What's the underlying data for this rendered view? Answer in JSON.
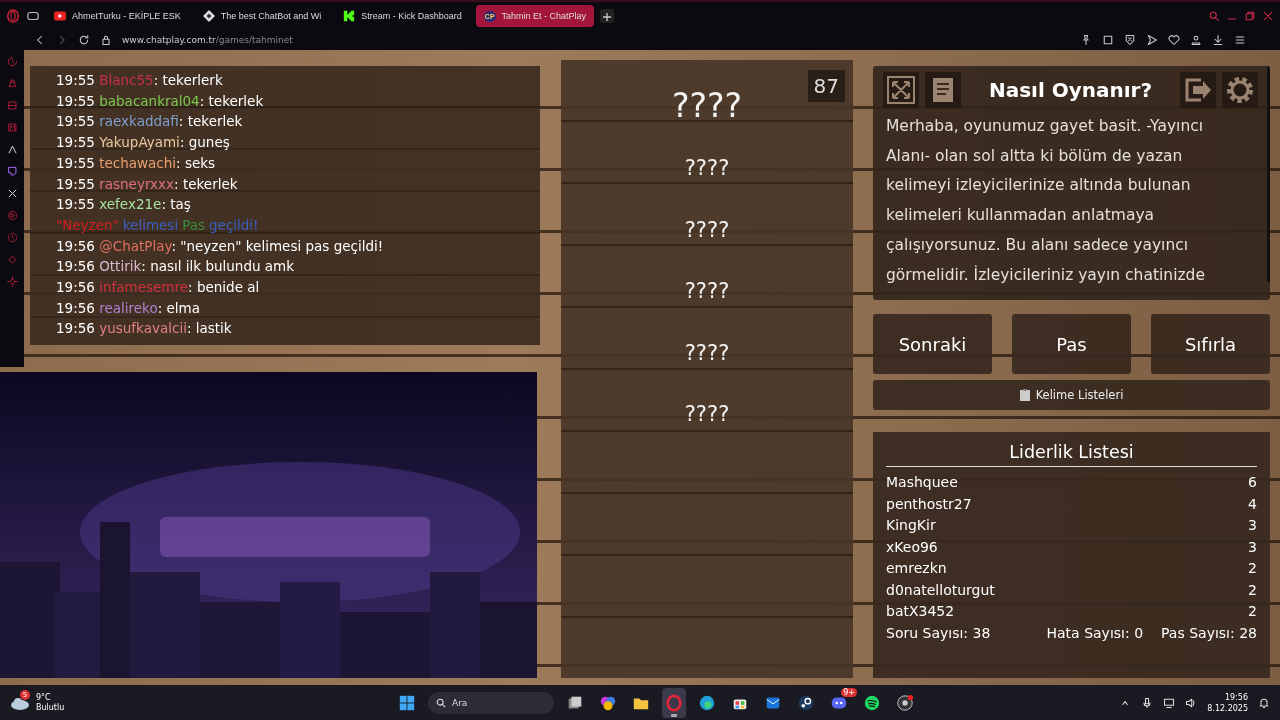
{
  "browser": {
    "tabs": [
      {
        "label": "AhmetTurku - EKİPLE ESK",
        "selected": false
      },
      {
        "label": "The best ChatBot and Wi",
        "selected": false
      },
      {
        "label": "Stream - Kick Dashboard",
        "selected": false
      },
      {
        "label": "Tahmin Et - ChatPlay",
        "badge": "CP",
        "selected": true
      }
    ],
    "address": {
      "domain": "www.chatplay.com.tr",
      "path": "/games/tahminet"
    }
  },
  "chat": {
    "messages": [
      {
        "kind": "message",
        "time": "19:55",
        "user": "Blanc55",
        "color": "#c8304a",
        "text": ": tekerlerk"
      },
      {
        "kind": "message",
        "time": "19:55",
        "user": "babacankral04",
        "color": "#7ec850",
        "text": ": tekerlek"
      },
      {
        "kind": "message",
        "time": "19:55",
        "user": "raexkaddafi",
        "color": "#7f9fd0",
        "text": ": tekerlek"
      },
      {
        "kind": "message",
        "time": "19:55",
        "user": "YakupAyami",
        "color": "#e8c8a0",
        "text": ": guneş"
      },
      {
        "kind": "message",
        "time": "19:55",
        "user": "techawachi",
        "color": "#e8a070",
        "text": ": seks"
      },
      {
        "kind": "message",
        "time": "19:55",
        "user": "rasneyrxxx",
        "color": "#e07080",
        "text": ": tekerlek"
      },
      {
        "kind": "message",
        "time": "19:55",
        "user": "xefex21e",
        "color": "#a8e0a0",
        "text": ": taş"
      },
      {
        "kind": "system",
        "parts": [
          {
            "text": "\"Neyzen\"",
            "color": "#d02020"
          },
          {
            "text": "kelimesi",
            "color": "#3a5fc0"
          },
          {
            "text": "Pas",
            "color": "#3a8a3a"
          },
          {
            "text": "geçildi!",
            "color": "#3a5fc0"
          }
        ]
      },
      {
        "kind": "message",
        "time": "19:56",
        "user": "@ChatPlay",
        "color": "#e07060",
        "text": ": \"neyzen\" kelimesi pas geçildi!"
      },
      {
        "kind": "message",
        "time": "19:56",
        "user": "Ottirik",
        "color": "#d8b8d0",
        "text": ": nasıl ilk bulundu amk"
      },
      {
        "kind": "message",
        "time": "19:56",
        "user": "infamesemre",
        "color": "#d03040",
        "text": ": benide al"
      },
      {
        "kind": "message",
        "time": "19:56",
        "user": "realireko",
        "color": "#b080d0",
        "text": ": elma"
      },
      {
        "kind": "message",
        "time": "19:56",
        "user": "yusufkavalcii",
        "color": "#e08080",
        "text": ": lastik"
      }
    ]
  },
  "stream_preview": {
    "kind": "picture"
  },
  "words": {
    "counter": "87",
    "items": [
      {
        "text": "????",
        "current": true
      },
      {
        "text": "????",
        "current": false
      },
      {
        "text": "????",
        "current": false
      },
      {
        "text": "????",
        "current": false
      },
      {
        "text": "????",
        "current": false
      },
      {
        "text": "????",
        "current": false
      }
    ]
  },
  "how_to": {
    "title": "Nasıl Oynanır?",
    "text": "Merhaba, oyunumuz gayet basit. -Yayıncı Alanı- olan sol altta ki bölüm de yazan kelimeyi izleyicilerinize altında bulunan kelimeleri kullanmadan anlatmaya çalışıyorsunuz. Bu alanı sadece yayıncı görmelidir. İzleyicileriniz yayın chatinizde"
  },
  "buttons": [
    "Sonraki",
    "Pas",
    "Sıfırla"
  ],
  "word_lists": {
    "label": "Kelime Listeleri"
  },
  "leaderboard": {
    "title": "Liderlik Listesi",
    "rows": [
      {
        "name": "Mashquee",
        "score": "6"
      },
      {
        "name": "penthostr27",
        "score": "4"
      },
      {
        "name": "KingKir",
        "score": "3"
      },
      {
        "name": "xKeo96",
        "score": "3"
      },
      {
        "name": "emrezkn",
        "score": "2"
      },
      {
        "name": "d0natelloturgut",
        "score": "2"
      },
      {
        "name": "batX3452",
        "score": "2"
      }
    ],
    "stats": [
      "Soru Sayısı: 38",
      "Hata Sayısı: 0",
      "Pas Sayısı: 28"
    ]
  },
  "taskbar": {
    "weather": {
      "temp": "9°C",
      "condition": "Bulutlu",
      "badge": "5"
    },
    "search": {
      "placeholder": "Ara"
    },
    "apps": [
      {
        "active": false
      },
      {
        "active": false
      },
      {
        "active": false
      },
      {
        "active": true
      },
      {
        "active": false
      },
      {
        "active": false
      },
      {
        "active": false
      },
      {
        "active": false
      },
      {
        "badge": "9+",
        "active": false
      },
      {
        "active": false
      },
      {
        "active": false
      }
    ],
    "clock": {
      "time": "19:56",
      "date": "8.12.2025"
    }
  }
}
